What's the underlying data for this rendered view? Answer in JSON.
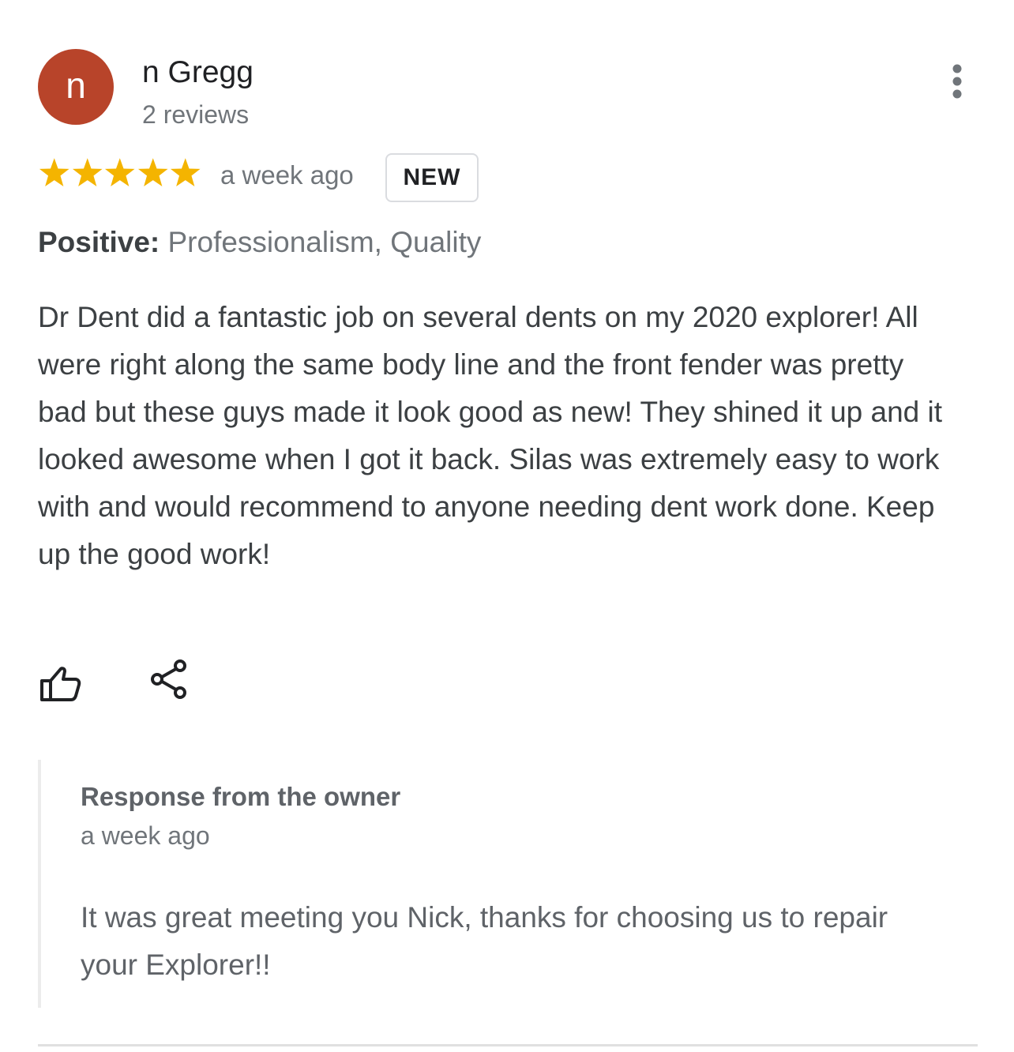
{
  "reviewer": {
    "initial": "n",
    "avatar_color": "#b8442a",
    "name": "n Gregg",
    "review_count": "2 reviews"
  },
  "review": {
    "rating": 5,
    "rating_max": 5,
    "star_color": "#f4b400",
    "time": "a week ago",
    "badge": "NEW",
    "positive_label": "Positive:",
    "positive_values": "Professionalism, Quality",
    "text": "Dr Dent did a fantastic job on several dents on my 2020 explorer! All were right along the same body line and the front fender was pretty bad but these guys made it look good as new! They shined it up and it looked awesome when I got it back. Silas was extremely easy to work with and would recommend to anyone needing dent work done. Keep up the good work!"
  },
  "actions": {
    "like_icon": "thumbs-up-icon",
    "share_icon": "share-icon",
    "more_icon": "more-vert-icon"
  },
  "owner_response": {
    "title": "Response from the owner",
    "time": "a week ago",
    "text": "It was great meeting you Nick, thanks for choosing us to repair your Explorer!!"
  }
}
